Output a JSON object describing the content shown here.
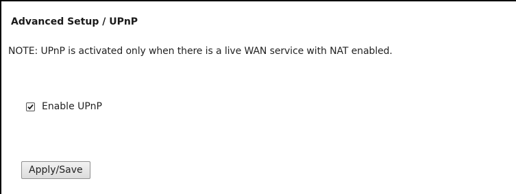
{
  "page": {
    "title": "Advanced Setup / UPnP",
    "note": "NOTE: UPnP is activated only when there is a live WAN service with NAT enabled."
  },
  "upnp": {
    "enable_label": "Enable UPnP",
    "enabled": true
  },
  "actions": {
    "apply_save_label": "Apply/Save"
  },
  "icons": {
    "checkbox_check": "check-icon"
  }
}
